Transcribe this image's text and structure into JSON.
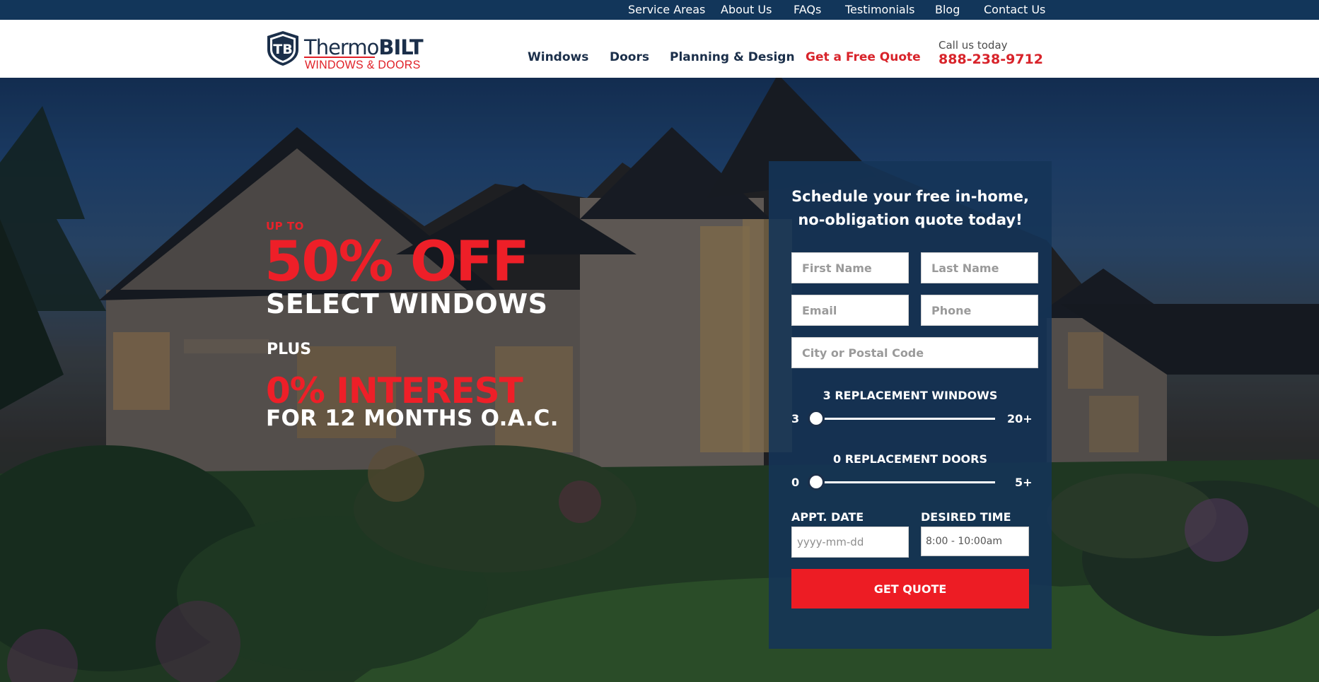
{
  "topbar": {
    "links": [
      "Service Areas",
      "About Us",
      "FAQs",
      "Testimonials",
      "Blog",
      "Contact Us"
    ]
  },
  "header": {
    "logo": {
      "word_light": "Thermo",
      "word_bold": "BILT",
      "sub": "WINDOWS & DOORS",
      "emblem": "TB"
    },
    "nav": [
      "Windows",
      "Doors",
      "Planning & Design",
      "Get a Free Quote"
    ],
    "callus": "Call us today",
    "phone": "888-238-9712"
  },
  "promo": {
    "upto": "UP TO",
    "big": "50% OFF",
    "select": "SELECT WINDOWS",
    "plus": "PLUS",
    "interest": "0% INTEREST",
    "months": "FOR 12 MONTHS O.A.C."
  },
  "form": {
    "title_line1": "Schedule your free in-home,",
    "title_line2": "no-obligation quote today!",
    "first_name_placeholder": "First Name",
    "last_name_placeholder": "Last Name",
    "email_placeholder": "Email",
    "phone_placeholder": "Phone",
    "city_placeholder": "City or Postal Code",
    "windows": {
      "label": "3 REPLACEMENT WINDOWS",
      "min": "3",
      "max": "20+",
      "value_fraction": 0
    },
    "doors": {
      "label": "0 REPLACEMENT DOORS",
      "min": "0",
      "max": "5+",
      "value_fraction": 0
    },
    "appt_label": "APPT. DATE",
    "appt_placeholder": "yyyy-mm-dd",
    "time_label": "DESIRED TIME",
    "time_value": "8:00 - 10:00am",
    "submit": "GET QUOTE"
  },
  "colors": {
    "navy": "#12365a",
    "red": "#ed1c24",
    "panel": "#153458"
  },
  "icons": [
    "tb-shield-logo-icon"
  ]
}
